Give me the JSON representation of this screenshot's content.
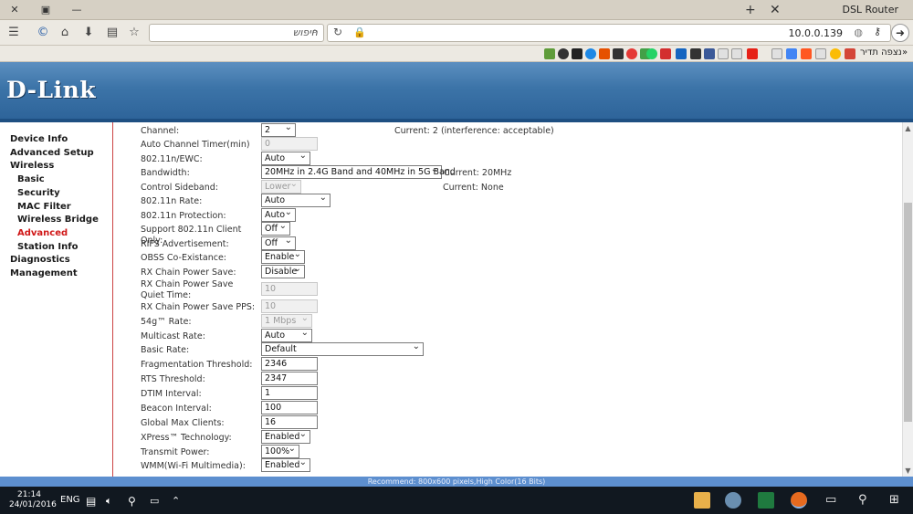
{
  "browser": {
    "window_title": "DSL Router",
    "search_placeholder": "חיפוש",
    "url": "10.0.0.139",
    "bookmark_text": "נצפה תדיר"
  },
  "router": {
    "logo": "D-Link",
    "sidebar": [
      {
        "label": "Device Info",
        "level": 0
      },
      {
        "label": "Advanced Setup",
        "level": 0
      },
      {
        "label": "Wireless",
        "level": 0
      },
      {
        "label": "Basic",
        "level": 1
      },
      {
        "label": "Security",
        "level": 1
      },
      {
        "label": "MAC Filter",
        "level": 1
      },
      {
        "label": "Wireless Bridge",
        "level": 1
      },
      {
        "label": "Advanced",
        "level": 1,
        "active": true
      },
      {
        "label": "Station Info",
        "level": 1
      },
      {
        "label": "Diagnostics",
        "level": 0
      },
      {
        "label": "Management",
        "level": 0
      }
    ],
    "settings": [
      {
        "label": "Channel:",
        "value": "2",
        "type": "select",
        "info": "Current: 2 (interference: acceptable)"
      },
      {
        "label": "Auto Channel Timer(min)",
        "value": "0",
        "type": "input",
        "disabled": true
      },
      {
        "label": "802.11n/EWC:",
        "value": "Auto",
        "type": "select"
      },
      {
        "label": "Bandwidth:",
        "value": "20MHz in 2.4G Band and 40MHz in 5G Band",
        "type": "select",
        "info": "Current: 20MHz"
      },
      {
        "label": "Control Sideband:",
        "value": "Lower",
        "type": "select",
        "disabled": true,
        "info": "Current: None"
      },
      {
        "label": "802.11n Rate:",
        "value": "Auto",
        "type": "select"
      },
      {
        "label": "802.11n Protection:",
        "value": "Auto",
        "type": "select"
      },
      {
        "label": "Support 802.11n Client Only:",
        "value": "Off",
        "type": "select"
      },
      {
        "label": "RIFS Advertisement:",
        "value": "Off",
        "type": "select"
      },
      {
        "label": "OBSS Co-Existance:",
        "value": "Enable",
        "type": "select"
      },
      {
        "label": "RX Chain Power Save:",
        "value": "Disable",
        "type": "select"
      },
      {
        "label": "RX Chain Power Save Quiet Time:",
        "value": "10",
        "type": "input",
        "disabled": true
      },
      {
        "label": "RX Chain Power Save PPS:",
        "value": "10",
        "type": "input",
        "disabled": true
      },
      {
        "label": "54g™ Rate:",
        "value": "1 Mbps",
        "type": "select",
        "disabled": true
      },
      {
        "label": "Multicast Rate:",
        "value": "Auto",
        "type": "select"
      },
      {
        "label": "Basic Rate:",
        "value": "Default",
        "type": "select"
      },
      {
        "label": "Fragmentation Threshold:",
        "value": "2346",
        "type": "input"
      },
      {
        "label": "RTS Threshold:",
        "value": "2347",
        "type": "input"
      },
      {
        "label": "DTIM Interval:",
        "value": "1",
        "type": "input"
      },
      {
        "label": "Beacon Interval:",
        "value": "100",
        "type": "input"
      },
      {
        "label": "Global Max Clients:",
        "value": "16",
        "type": "input"
      },
      {
        "label": "XPress™ Technology:",
        "value": "Enabled",
        "type": "select"
      },
      {
        "label": "Transmit Power:",
        "value": "100%",
        "type": "select"
      },
      {
        "label": "WMM(Wi-Fi Multimedia):",
        "value": "Enabled",
        "type": "select"
      }
    ],
    "status": "Recommend: 800x600 pixels,High Color(16 Bits)"
  },
  "taskbar": {
    "time": "21:14",
    "date": "24/01/2016",
    "language": "ENG"
  },
  "colors": {
    "banner": "#3c74a8",
    "active_menu": "#d01818",
    "status_bar": "#5d8fcf"
  }
}
